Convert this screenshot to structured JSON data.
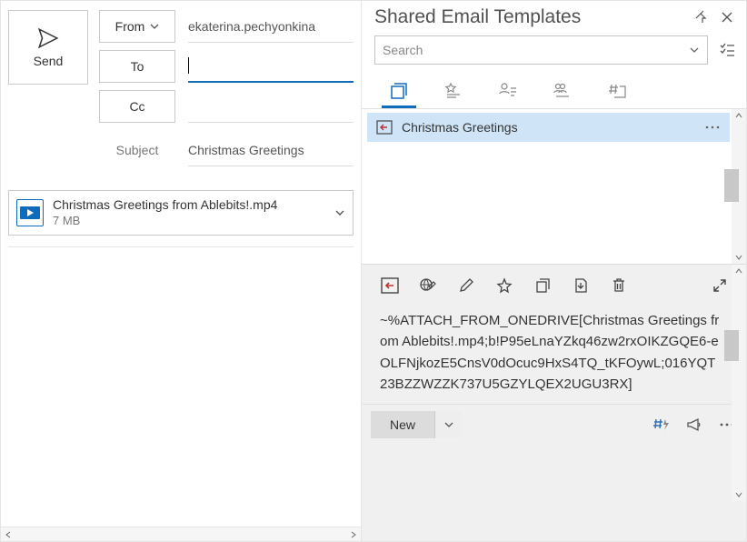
{
  "compose": {
    "send": "Send",
    "from_label": "From",
    "from_value": "ekaterina.pechyonkina",
    "to_label": "To",
    "to_value": "",
    "cc_label": "Cc",
    "cc_value": "",
    "subject_label": "Subject",
    "subject_value": "Christmas Greetings"
  },
  "attachment": {
    "name": "Christmas Greetings from Ablebits!.mp4",
    "size": "7 MB"
  },
  "panel": {
    "title": "Shared Email Templates",
    "search_placeholder": "Search"
  },
  "template_item": {
    "name": "Christmas Greetings"
  },
  "preview_text": "~%ATTACH_FROM_ONEDRIVE[Christmas Greetings from Ablebits!.mp4;b!P95eLnaYZkq46zw2rxOIKZGQE6-eOLFNjkozE5CnsV0dOcuc9HxS4TQ_tKFOywL;016YQT23BZZWZZK737U5GZYLQEX2UGU3RX]",
  "footer": {
    "new": "New"
  }
}
